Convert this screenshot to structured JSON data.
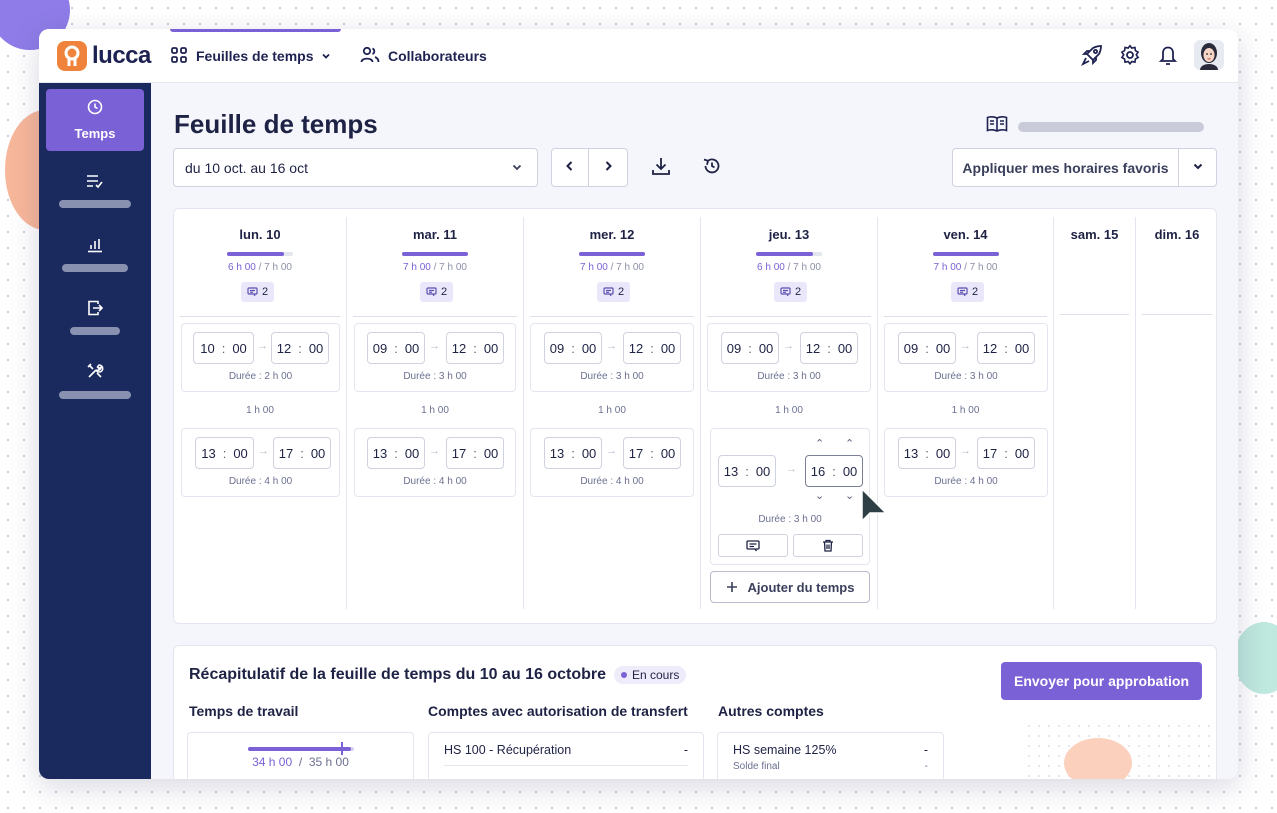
{
  "app": {
    "brand": "lucca"
  },
  "nav": {
    "timesheets_label": "Feuilles de temps",
    "collaborators_label": "Collaborateurs"
  },
  "sidebar": {
    "active_label": "Temps"
  },
  "page": {
    "title": "Feuille de temps",
    "date_range": "du 10 oct. au 16 oct",
    "favorite_schedule_button": "Appliquer mes horaires favoris"
  },
  "days": [
    {
      "label": "lun. 10",
      "done": "6 h 00",
      "target": "7 h 00",
      "progress": 0.857,
      "badge": "2",
      "slots": [
        {
          "start_h": "10",
          "start_m": "00",
          "end_h": "12",
          "end_m": "00",
          "duration": "Durée : 2 h 00"
        },
        {
          "start_h": "13",
          "start_m": "00",
          "end_h": "17",
          "end_m": "00",
          "duration": "Durée : 4 h 00"
        }
      ],
      "break": "1 h 00"
    },
    {
      "label": "mar. 11",
      "done": "7 h 00",
      "target": "7 h 00",
      "progress": 1.0,
      "badge": "2",
      "slots": [
        {
          "start_h": "09",
          "start_m": "00",
          "end_h": "12",
          "end_m": "00",
          "duration": "Durée : 3 h 00"
        },
        {
          "start_h": "13",
          "start_m": "00",
          "end_h": "17",
          "end_m": "00",
          "duration": "Durée : 4 h 00"
        }
      ],
      "break": "1 h 00"
    },
    {
      "label": "mer. 12",
      "done": "7 h 00",
      "target": "7 h 00",
      "progress": 1.0,
      "badge": "2",
      "slots": [
        {
          "start_h": "09",
          "start_m": "00",
          "end_h": "12",
          "end_m": "00",
          "duration": "Durée : 3 h 00"
        },
        {
          "start_h": "13",
          "start_m": "00",
          "end_h": "17",
          "end_m": "00",
          "duration": "Durée : 4 h 00"
        }
      ],
      "break": "1 h 00"
    },
    {
      "label": "jeu. 13",
      "done": "6 h 00",
      "target": "7 h 00",
      "progress": 0.857,
      "badge": "2",
      "slots": [
        {
          "start_h": "09",
          "start_m": "00",
          "end_h": "12",
          "end_m": "00",
          "duration": "Durée : 3 h 00"
        },
        {
          "start_h": "13",
          "start_m": "00",
          "end_h": "16",
          "end_m": "00",
          "duration": "Durée : 3 h 00"
        }
      ],
      "break": "1 h 00",
      "add_time_label": "Ajouter du temps"
    },
    {
      "label": "ven. 14",
      "done": "7 h 00",
      "target": "7 h 00",
      "progress": 1.0,
      "badge": "2",
      "slots": [
        {
          "start_h": "09",
          "start_m": "00",
          "end_h": "12",
          "end_m": "00",
          "duration": "Durée : 3 h 00"
        },
        {
          "start_h": "13",
          "start_m": "00",
          "end_h": "17",
          "end_m": "00",
          "duration": "Durée : 4 h 00"
        }
      ],
      "break": "1 h 00"
    },
    {
      "label": "sam. 15"
    },
    {
      "label": "dim. 16"
    }
  ],
  "time_separator": ":",
  "hours_separator": "/",
  "summary": {
    "title": "Récapitulatif de la feuille de temps du 10 au 16 octobre",
    "status": "En cours",
    "send_button": "Envoyer pour approbation",
    "work_time": {
      "heading": "Temps de travail",
      "done": "34 h 00",
      "target": "35 h 00",
      "progress": 0.971
    },
    "transfer_accounts": {
      "heading": "Comptes avec autorisation de transfert",
      "row_label": "HS 100 - Récupération",
      "row_value": "-"
    },
    "other_accounts": {
      "heading": "Autres comptes",
      "row_label": "HS semaine 125%",
      "row_value": "-",
      "sub_label": "Solde final",
      "sub_value": "-"
    }
  },
  "colors": {
    "accent": "#7b61d6",
    "sidebar": "#1b2a5e",
    "brand_orange": "#f0833b"
  },
  "icons": {
    "nav": [
      "apps-grid-icon",
      "users-icon"
    ],
    "top": [
      "rocket-icon",
      "gear-icon",
      "bell-icon"
    ],
    "sidebar": [
      "clock-icon",
      "list-check-icon",
      "chart-icon",
      "exit-icon",
      "tools-icon"
    ],
    "toolbar": [
      "chevron-left-icon",
      "chevron-right-icon",
      "download-icon",
      "history-icon",
      "book-icon"
    ]
  }
}
